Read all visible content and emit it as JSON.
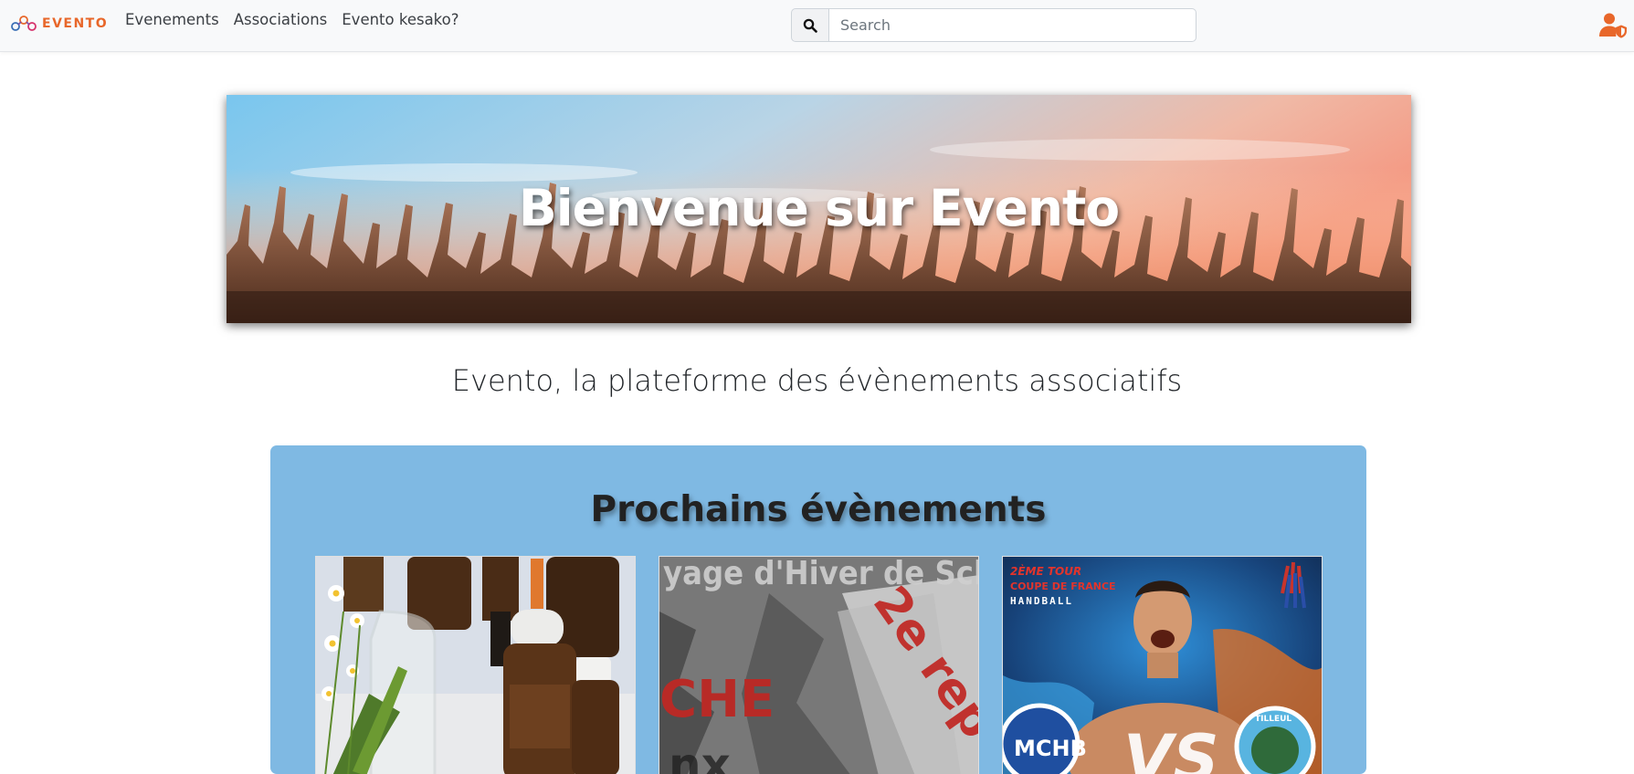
{
  "navbar": {
    "brand": "EVENTO",
    "links": [
      "Evenements",
      "Associations",
      "Evento kesako?"
    ],
    "search": {
      "placeholder": "Search",
      "value": ""
    },
    "icons": {
      "search": "search-icon",
      "user": "user-shield-icon"
    }
  },
  "hero": {
    "title": "Bienvenue sur Evento"
  },
  "tagline": "Evento, la plateforme des évènements associatifs",
  "upcoming": {
    "title": "Prochains évènements",
    "cards": [
      {
        "image": "essential-oils-bottles-and-flowers"
      },
      {
        "image": "winter-trip-poster",
        "visible_text": [
          "yage d'Hiver de Sch",
          "2e rep",
          "CHE"
        ]
      },
      {
        "image": "handball-match-poster",
        "visible_text": [
          "2ÈME TOUR",
          "COUPE DE FRANCE",
          "HANDBALL",
          "MCHB",
          "VS",
          "TILLEUL"
        ]
      }
    ]
  },
  "colors": {
    "brand": "#e8672a",
    "navbar_bg": "#f8f9fa",
    "events_bg": "#7fb9e3"
  }
}
